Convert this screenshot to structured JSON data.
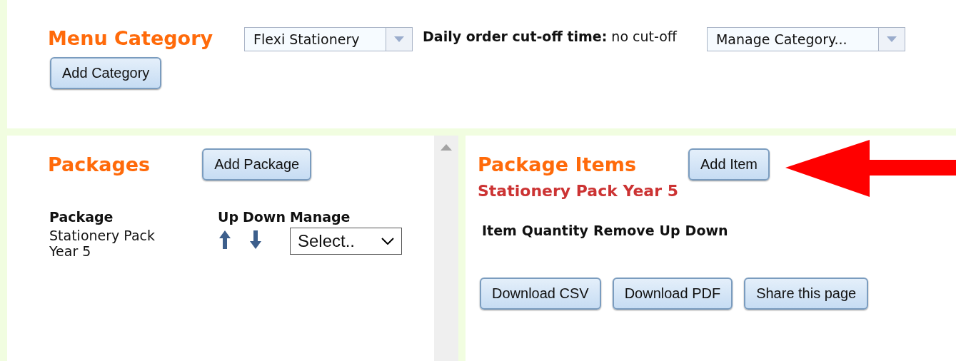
{
  "menu_category": {
    "title": "Menu Category",
    "category_select": {
      "value": "Flexi Stationery"
    },
    "cutoff": {
      "label": "Daily order cut-off time:",
      "value": "no cut-off"
    },
    "manage_select": {
      "value": "Manage Category..."
    },
    "add_button": "Add Category"
  },
  "packages": {
    "title": "Packages",
    "add_button": "Add Package",
    "columns": [
      "Package",
      "Up",
      "Down",
      "Manage"
    ],
    "rows": [
      {
        "name": "Stationery Pack Year 5",
        "manage": "Select.."
      }
    ]
  },
  "package_items": {
    "title": "Package Items",
    "add_button": "Add Item",
    "package_name": "Stationery Pack Year 5",
    "columns": [
      "Item",
      "Quantity",
      "Remove",
      "Up",
      "Down"
    ],
    "buttons": [
      "Download CSV",
      "Download PDF",
      "Share this page"
    ]
  }
}
